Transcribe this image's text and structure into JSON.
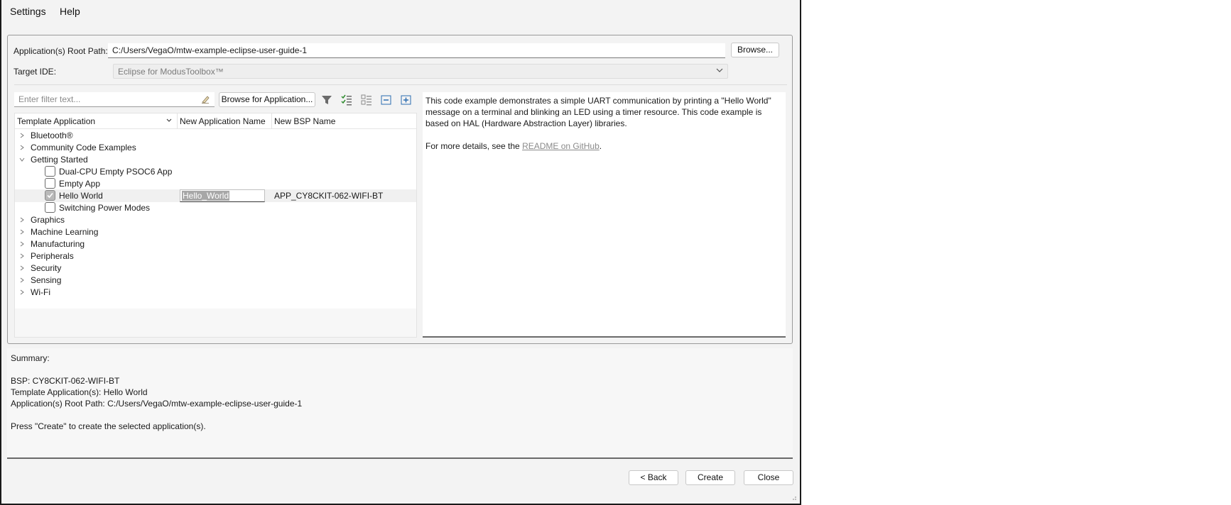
{
  "menu": {
    "settings": "Settings",
    "help": "Help"
  },
  "root_path": {
    "label": "Application(s) Root Path:",
    "value": "C:/Users/VegaO/mtw-example-eclipse-user-guide-1",
    "browse_label": "Browse..."
  },
  "target_ide": {
    "label": "Target IDE:",
    "value": "Eclipse for ModusToolbox™"
  },
  "filter": {
    "placeholder": "Enter filter text...",
    "browse_label": "Browse for Application..."
  },
  "table": {
    "headers": [
      "Template Application",
      "New Application Name",
      "New BSP Name"
    ],
    "tree": [
      {
        "label": "Bluetooth®",
        "expanded": false
      },
      {
        "label": "Community Code Examples",
        "expanded": false
      },
      {
        "label": "Getting Started",
        "expanded": true,
        "children": [
          {
            "label": "Dual-CPU Empty PSOC6 App",
            "checked": false
          },
          {
            "label": "Empty App",
            "checked": false
          },
          {
            "label": "Hello World",
            "checked": true,
            "app_name": "Hello_World",
            "bsp_name": "APP_CY8CKIT-062-WIFI-BT"
          },
          {
            "label": "Switching Power Modes",
            "checked": false
          }
        ]
      },
      {
        "label": "Graphics",
        "expanded": false
      },
      {
        "label": "Machine Learning",
        "expanded": false
      },
      {
        "label": "Manufacturing",
        "expanded": false
      },
      {
        "label": "Peripherals",
        "expanded": false
      },
      {
        "label": "Security",
        "expanded": false
      },
      {
        "label": "Sensing",
        "expanded": false
      },
      {
        "label": "Wi-Fi",
        "expanded": false
      }
    ]
  },
  "description": {
    "text": "This code example demonstrates a simple UART communication by printing a \"Hello World\" message on a terminal and blinking an LED using a timer resource. This code example is based on HAL (Hardware Abstraction Layer) libraries.",
    "more_prefix": "For more details, see the ",
    "link_text": "README on GitHub",
    "more_suffix": "."
  },
  "summary": {
    "title": "Summary:",
    "bsp": "BSP: CY8CKIT-062-WIFI-BT",
    "template": "Template Application(s): Hello World",
    "root": "Application(s) Root Path: C:/Users/VegaO/mtw-example-eclipse-user-guide-1",
    "hint": "Press \"Create\" to create the selected application(s)."
  },
  "buttons": {
    "back": "< Back",
    "create": "Create",
    "close": "Close"
  },
  "colors": {
    "accent_filter": "#5a5a5a",
    "checked_box": "#b9b9b9",
    "link": "#8a8a8a"
  }
}
